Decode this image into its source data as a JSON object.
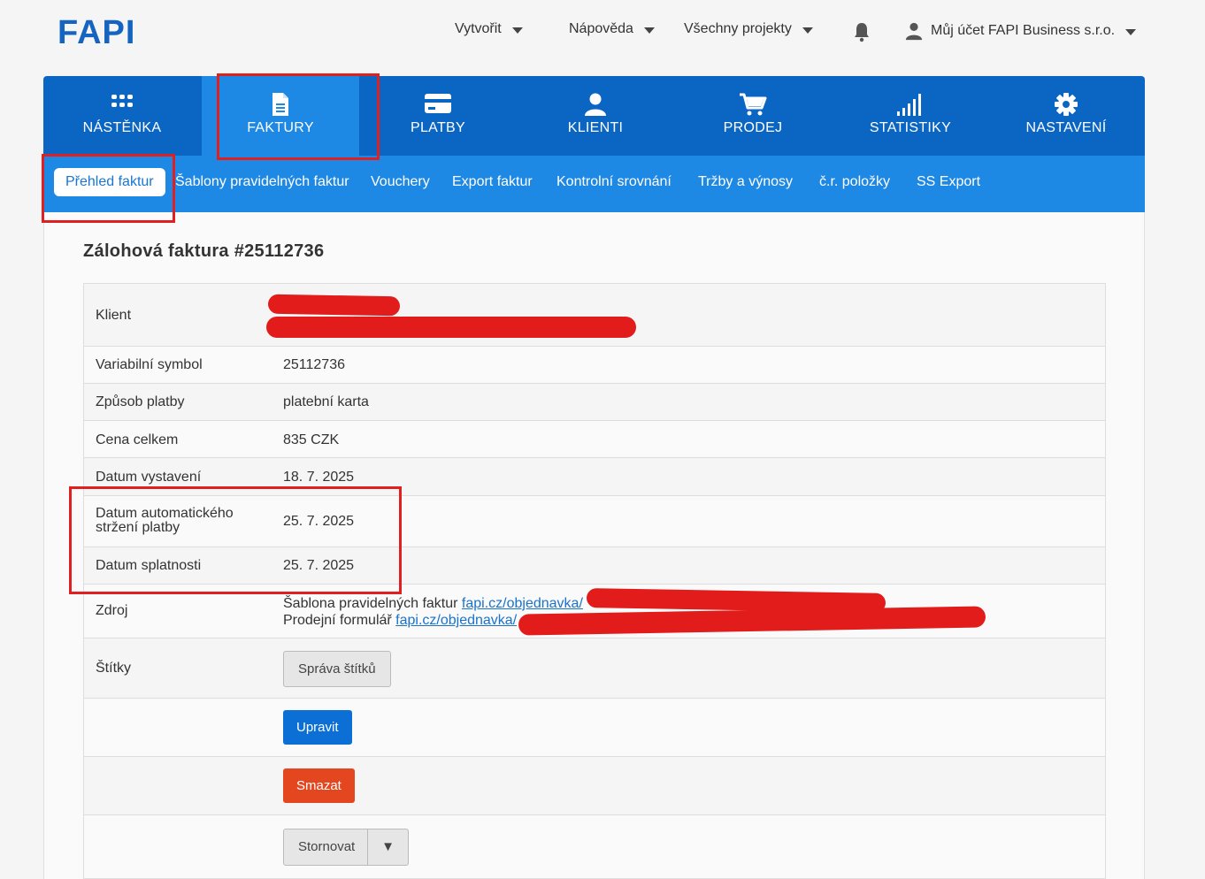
{
  "header": {
    "logo": "FAPI",
    "create": "Vytvořit",
    "help": "Nápověda",
    "projects": "Všechny projekty",
    "account": "Můj účet FAPI Business s.r.o."
  },
  "main_nav": [
    {
      "label": "NÁSTĚNKA",
      "icon": "dashboard-grid-icon"
    },
    {
      "label": "FAKTURY",
      "icon": "invoice-document-icon"
    },
    {
      "label": "PLATBY",
      "icon": "credit-card-icon"
    },
    {
      "label": "KLIENTI",
      "icon": "person-icon"
    },
    {
      "label": "PRODEJ",
      "icon": "shopping-cart-icon"
    },
    {
      "label": "STATISTIKY",
      "icon": "bar-signal-icon"
    },
    {
      "label": "NASTAVENÍ",
      "icon": "gear-icon"
    }
  ],
  "sub_nav": [
    "Přehled faktur",
    "Šablony pravidelných faktur",
    "Vouchery",
    "Export faktur",
    "Kontrolní srovnání",
    "Tržby a výnosy",
    "č.r. položky",
    "SS Export"
  ],
  "invoice": {
    "title": "Zálohová faktura #25112736",
    "rows": {
      "client_label": "Klient",
      "vs_label": "Variabilní symbol",
      "vs_value": "25112736",
      "payment_label": "Způsob platby",
      "payment_value": "platební karta",
      "total_label": "Cena celkem",
      "total_value": "835 CZK",
      "issued_label": "Datum vystavení",
      "issued_value": "18. 7. 2025",
      "auto_label_1": "Datum automatického",
      "auto_label_2": "stržení platby",
      "auto_value": "25. 7. 2025",
      "due_label": "Datum splatnosti",
      "due_value": "25. 7. 2025",
      "source_label": "Zdroj",
      "source_line1_text": "Šablona pravidelných faktur",
      "source_line1_link": "fapi.cz/objednavka/",
      "source_line2_text": "Prodejní formulář",
      "source_line2_link": "fapi.cz/objednavka/",
      "tags_label": "Štítky"
    },
    "buttons": {
      "tags": "Správa štítků",
      "edit": "Upravit",
      "delete": "Smazat",
      "cancel": "Stornovat",
      "cancel_arrow": "▼"
    }
  },
  "colors": {
    "brand": "#1565c0",
    "nav": "#0b66c3",
    "subnav": "#1e88e5",
    "delete": "#e4471f",
    "highlight": "#e02020"
  }
}
